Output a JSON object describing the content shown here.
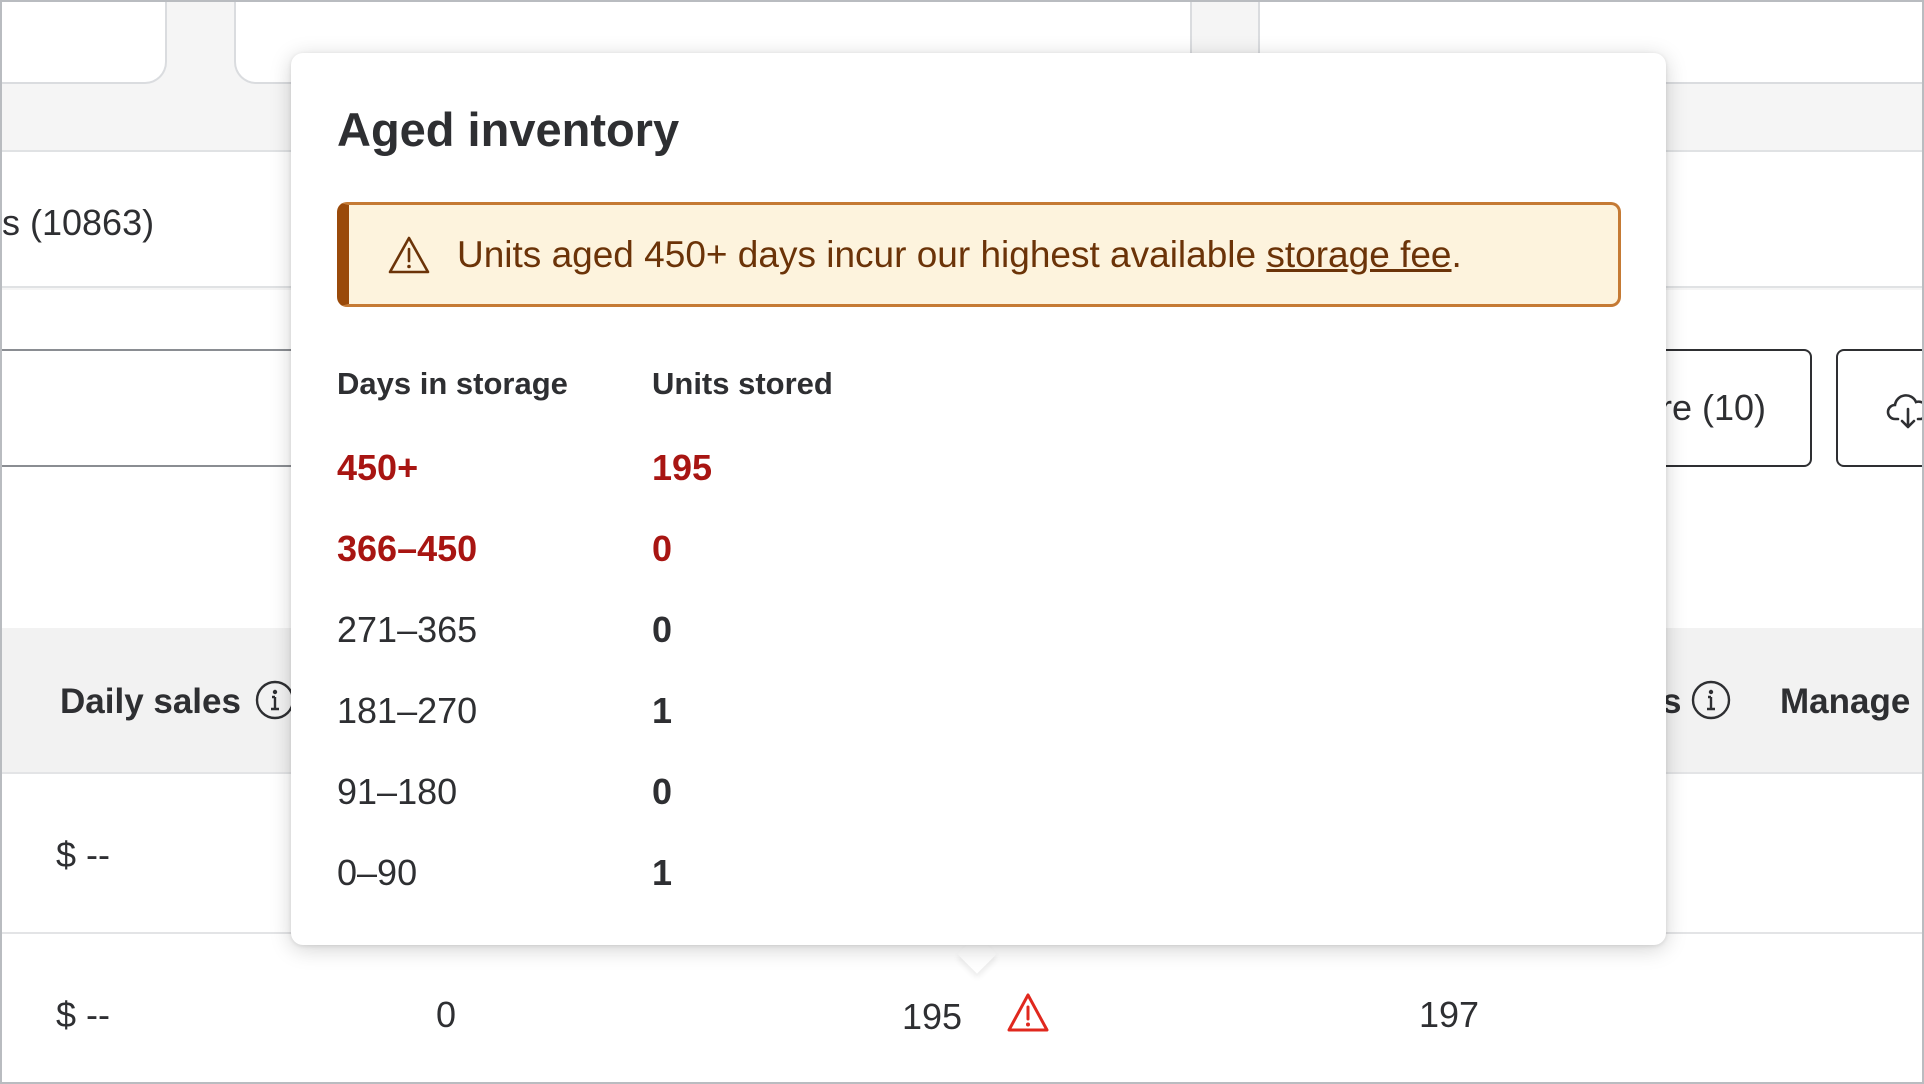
{
  "background": {
    "tab_label_partial": "s (10863)",
    "filter_button_partial": "re (10)",
    "table": {
      "headers": {
        "daily_sales": "Daily sales",
        "partial_col": "s",
        "manage": "Manage"
      },
      "rows": [
        {
          "daily_sales": "$ --"
        },
        {
          "daily_sales": "$ --",
          "col_b": "0",
          "col_c": "195",
          "col_d": "197"
        }
      ]
    }
  },
  "popover": {
    "title": "Aged inventory",
    "alert": {
      "text_before": "Units aged 450+ days incur our highest available ",
      "link_text": "storage fee",
      "text_after": "."
    },
    "columns": {
      "days": "Days in storage",
      "units": "Units stored"
    },
    "rows": [
      {
        "days": "450+",
        "units": "195"
      },
      {
        "days": "366–450",
        "units": "0"
      },
      {
        "days": "271–365",
        "units": "0"
      },
      {
        "days": "181–270",
        "units": "1"
      },
      {
        "days": "91–180",
        "units": "0"
      },
      {
        "days": "0–90",
        "units": "1"
      }
    ]
  },
  "colors": {
    "danger": "#a81512",
    "alert_bg": "#fdf3dd",
    "alert_border": "#c57a34",
    "alert_accent": "#9a4a0a",
    "warning_icon": "#e0281e"
  }
}
